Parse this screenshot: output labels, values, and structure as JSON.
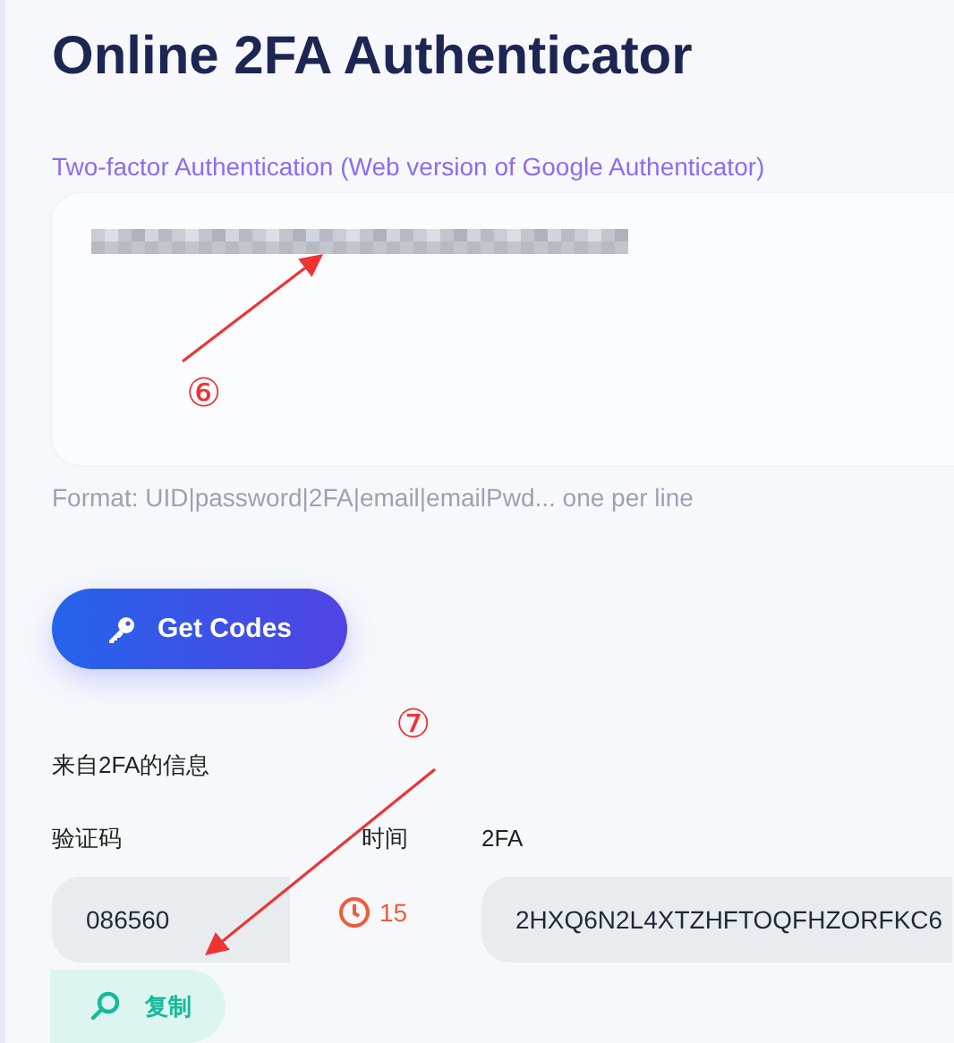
{
  "title": "Online 2FA Authenticator",
  "subtitle": "Two-factor Authentication (Web version of Google Authenticator)",
  "input": {
    "redacted": true
  },
  "format_hint": "Format: UID|password|2FA|email|emailPwd... one per line",
  "get_codes_button": "Get Codes",
  "result": {
    "heading": "来自2FA的信息",
    "columns": [
      "验证码",
      "时间",
      "2FA"
    ],
    "code": "086560",
    "seconds": "15",
    "secret": "2HXQ6N2L4XTZHFTOQFHZORFKC6",
    "copy_button": "复制"
  },
  "annotations": [
    {
      "label": "⑥"
    },
    {
      "label": "⑦"
    }
  ]
}
